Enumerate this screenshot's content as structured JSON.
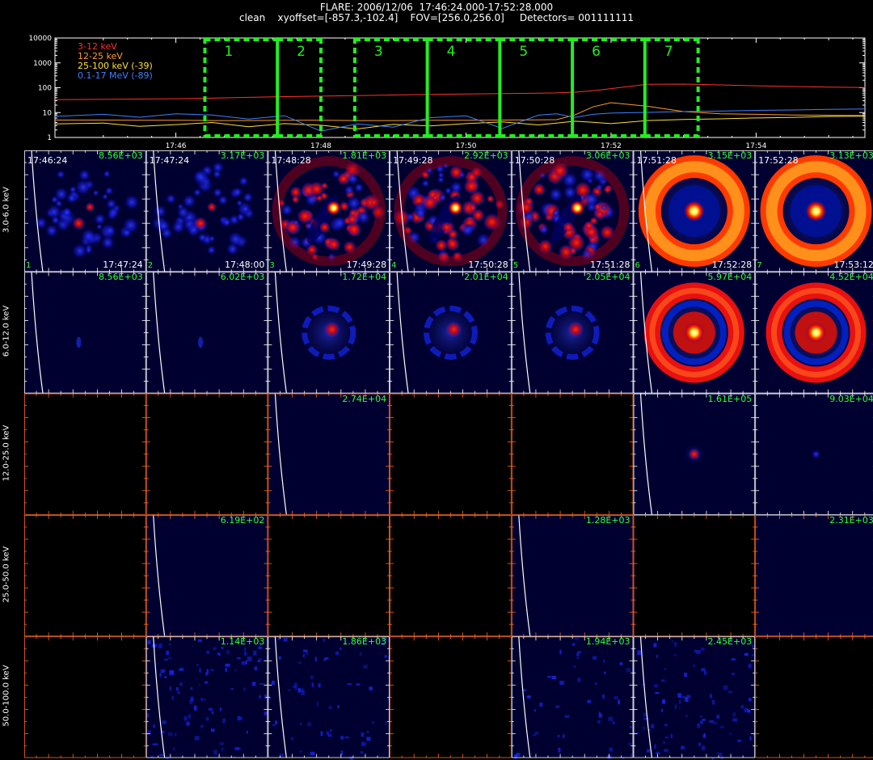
{
  "header": {
    "line1": "FLARE: 2006/12/06  17:46:24.000-17:52:28.000",
    "line2": "clean    xyoffset=[-857.3,-102.4]    FOV=[256.0,256.0]     Detectors= 001111111"
  },
  "chart_data": [
    {
      "type": "line",
      "title": "FLARE: 2006/12/06  17:46:24.000-17:52:28.000",
      "yscale": "log",
      "ylim": [
        1,
        10000
      ],
      "ytick_labels": [
        "1",
        "10",
        "100",
        "1000",
        "10000"
      ],
      "xrange_minutes": [
        "17:44:20",
        "17:55:30"
      ],
      "xtick_labels": [
        "17:46",
        "17:48",
        "17:50",
        "17:52",
        "17:54"
      ],
      "xtick_times": [
        "17:46",
        "17:48",
        "17:50",
        "17:52",
        "17:54"
      ],
      "x": [
        "17:44:20",
        "17:45:00",
        "17:45:30",
        "17:46:00",
        "17:46:30",
        "17:47:00",
        "17:47:30",
        "17:48:00",
        "17:48:30",
        "17:49:00",
        "17:49:30",
        "17:50:00",
        "17:50:30",
        "17:51:00",
        "17:51:15",
        "17:51:30",
        "17:51:45",
        "17:52:00",
        "17:52:30",
        "17:53:00",
        "17:53:30",
        "17:54:00",
        "17:54:30",
        "17:55:00",
        "17:55:30"
      ],
      "series": [
        {
          "name": "3-12 keV",
          "color": "#ff3030",
          "values": [
            33,
            34,
            35,
            36,
            38,
            41,
            44,
            46,
            48,
            51,
            54,
            56,
            58,
            60,
            62,
            66,
            75,
            92,
            138,
            140,
            130,
            120,
            112,
            106,
            102
          ]
        },
        {
          "name": "12-25 keV",
          "color": "#ff9a30",
          "values": [
            5,
            5,
            4.9,
            4.9,
            4.8,
            4.8,
            4.9,
            4.9,
            4.8,
            4.8,
            4.9,
            4.9,
            5,
            5.1,
            5.2,
            8,
            17,
            25,
            18,
            11,
            9,
            8.5,
            8,
            7.8,
            7.6
          ]
        },
        {
          "name": "25-100 keV (-39)",
          "color": "#ffe030",
          "values": [
            3.5,
            3.8,
            2.8,
            3.3,
            4,
            2.7,
            3.6,
            3.1,
            2.2,
            3.4,
            2.9,
            3.6,
            4.2,
            3.2,
            3.8,
            4.5,
            4.1,
            3.6,
            4.8,
            5.3,
            5.6,
            6.1,
            6.4,
            7,
            7.2
          ]
        },
        {
          "name": "0.1-17 MeV (-89)",
          "color": "#4080ff",
          "values": [
            7,
            8.5,
            6.5,
            9,
            8,
            5.5,
            7.5,
            1.8,
            3.5,
            2.6,
            6.2,
            7.4,
            2.3,
            7.9,
            9,
            6.4,
            8.5,
            9.5,
            10.2,
            11,
            11.5,
            12.3,
            12.8,
            13.5,
            14
          ]
        }
      ],
      "time_intervals": [
        {
          "label": "1",
          "start": "17:46:24",
          "end": "17:47:24"
        },
        {
          "label": "2",
          "start": "17:47:24",
          "end": "17:48:00"
        },
        {
          "label": "3",
          "start": "17:48:28",
          "end": "17:49:28"
        },
        {
          "label": "4",
          "start": "17:49:28",
          "end": "17:50:28"
        },
        {
          "label": "5",
          "start": "17:50:28",
          "end": "17:51:28"
        },
        {
          "label": "6",
          "start": "17:51:28",
          "end": "17:52:28"
        },
        {
          "label": "7",
          "start": "17:52:28",
          "end": "17:53:12"
        }
      ]
    },
    {
      "type": "heatmap",
      "description_kind": "image_grid",
      "row_labels": [
        "3.0-6.0 keV",
        "6.0-12.0 keV",
        "12.0-25.0 keV",
        "25.0-50.0 keV",
        "50.0-100.0 keV"
      ],
      "columns": [
        {
          "index": "1",
          "start": "17:46:24",
          "end": "17:47:24"
        },
        {
          "index": "2",
          "start": "17:47:24",
          "end": "17:48:00"
        },
        {
          "index": "3",
          "start": "17:48:28",
          "end": "17:49:28"
        },
        {
          "index": "4",
          "start": "17:49:28",
          "end": "17:50:28"
        },
        {
          "index": "5",
          "start": "17:50:28",
          "end": "17:51:28"
        },
        {
          "index": "6",
          "start": "17:51:28",
          "end": "17:52:28"
        },
        {
          "index": "7",
          "start": "17:52:28",
          "end": "17:53:12"
        }
      ],
      "peaks": [
        [
          "8.56E+03",
          "3.17E+03",
          "1.81E+03",
          "2.92E+03",
          "3.06E+03",
          "3.15E+03",
          "3.13E+03"
        ],
        [
          "8.56E+03",
          "6.02E+03",
          "1.72E+04",
          "2.01E+04",
          "2.05E+04",
          "5.97E+04",
          "4.52E+04"
        ],
        [
          "",
          "",
          "2.74E+04",
          "",
          "",
          "1.61E+05",
          "9.03E+04"
        ],
        [
          "",
          "6.19E+02",
          "",
          "",
          "1.28E+03",
          "",
          "2.31E+03"
        ],
        [
          "",
          "1.14E+03",
          "1.86E+03",
          "",
          "1.94E+03",
          "2.45E+03",
          ""
        ]
      ],
      "images": [
        [
          {
            "kind": "blotchy",
            "level": 0.45
          },
          {
            "kind": "blotchy",
            "level": 0.35
          },
          {
            "kind": "ring-speckle",
            "level": 0.75
          },
          {
            "kind": "ring-speckle",
            "level": 0.75
          },
          {
            "kind": "ring-speckle",
            "level": 0.8
          },
          {
            "kind": "ring-bright",
            "level": 1.0
          },
          {
            "kind": "ring-bright",
            "level": 1.0
          }
        ],
        [
          {
            "kind": "faint",
            "level": 0.15
          },
          {
            "kind": "faint",
            "level": 0.15
          },
          {
            "kind": "small-ring",
            "level": 0.5
          },
          {
            "kind": "small-ring",
            "level": 0.55
          },
          {
            "kind": "small-ring",
            "level": 0.55
          },
          {
            "kind": "big-ring",
            "level": 1.0
          },
          {
            "kind": "big-ring",
            "level": 0.9
          }
        ],
        [
          {
            "kind": "empty",
            "level": 0
          },
          {
            "kind": "empty",
            "level": 0
          },
          {
            "kind": "blank-blue",
            "level": 0
          },
          {
            "kind": "empty",
            "level": 0
          },
          {
            "kind": "empty",
            "level": 0
          },
          {
            "kind": "point",
            "level": 1.0
          },
          {
            "kind": "point-faint",
            "level": 0.5
          }
        ],
        [
          {
            "kind": "empty",
            "level": 0
          },
          {
            "kind": "blank-blue",
            "level": 0
          },
          {
            "kind": "empty",
            "level": 0
          },
          {
            "kind": "empty",
            "level": 0
          },
          {
            "kind": "blank-blue",
            "level": 0
          },
          {
            "kind": "empty",
            "level": 0
          },
          {
            "kind": "blank-blue",
            "level": 0
          }
        ],
        [
          {
            "kind": "empty",
            "level": 0
          },
          {
            "kind": "noise",
            "level": 0.3
          },
          {
            "kind": "noise",
            "level": 0.2
          },
          {
            "kind": "empty",
            "level": 0
          },
          {
            "kind": "noise",
            "level": 0.15
          },
          {
            "kind": "noise",
            "level": 0.25
          },
          {
            "kind": "empty",
            "level": 0
          }
        ]
      ],
      "limb_columns": [
        1,
        2,
        3,
        4,
        5,
        6
      ]
    }
  ]
}
